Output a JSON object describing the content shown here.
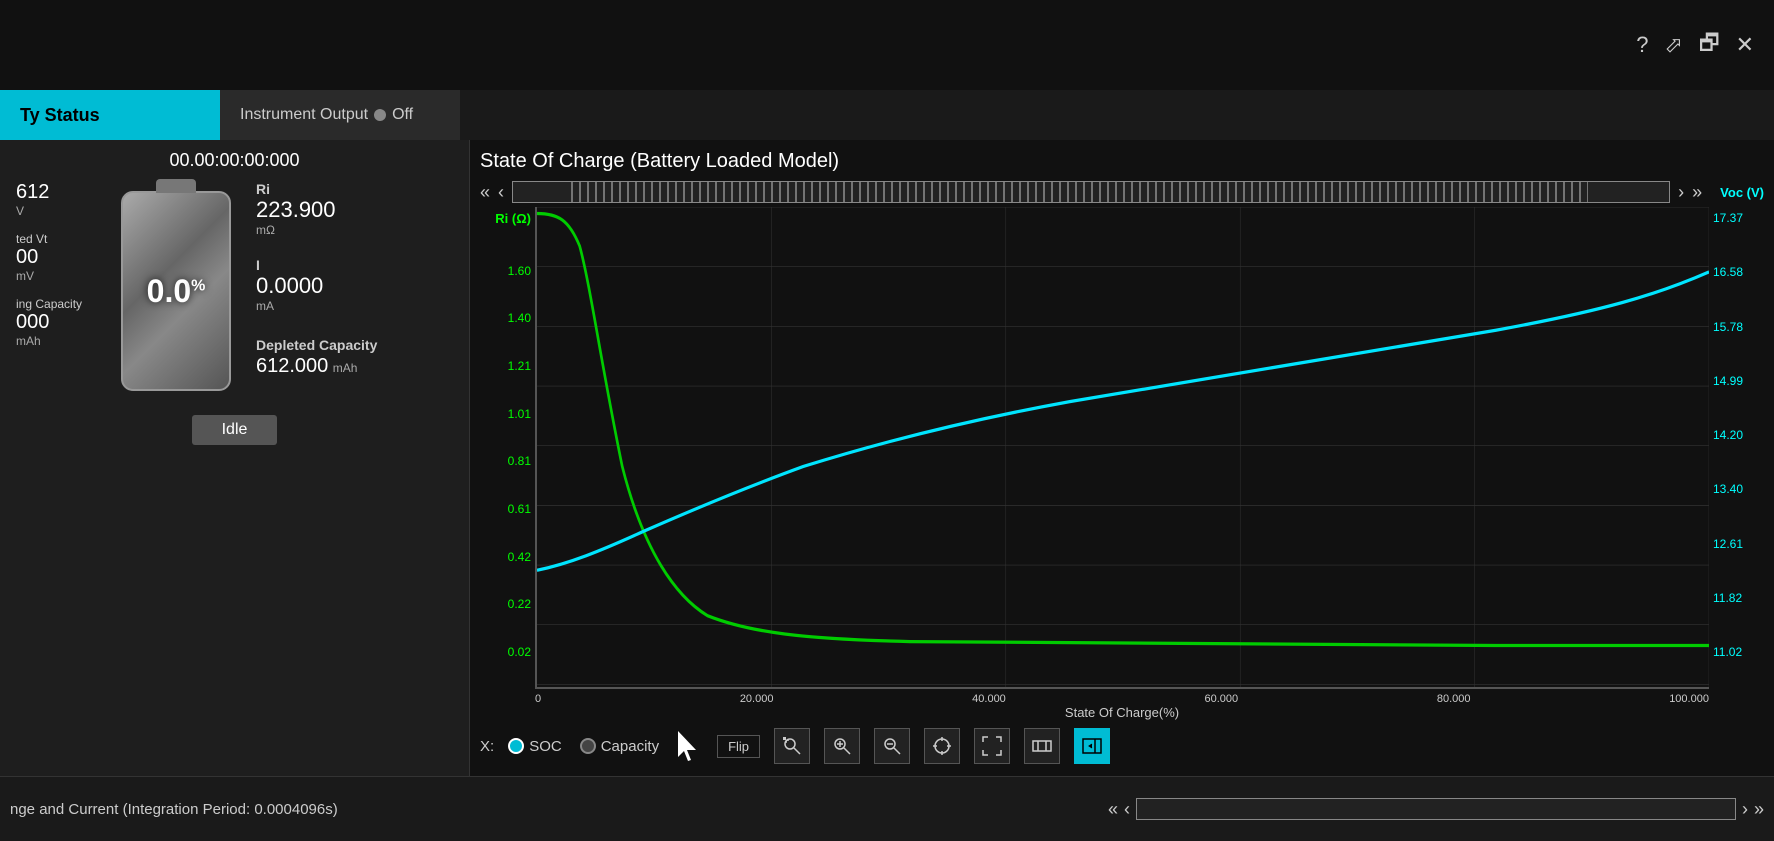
{
  "topbar": {
    "help_icon": "?",
    "export_icon": "⬀",
    "minimize_icon": "🗗",
    "close_icon": "✕"
  },
  "tabs": {
    "battery_status": "Ty Status",
    "instrument_output": "Instrument Output",
    "instrument_led": "Off"
  },
  "left_panel": {
    "timer": "00.00:00:00:000",
    "voltage_value": "612",
    "voltage_unit": "V",
    "loaded_vt_label": "ted Vt",
    "loaded_vt_value": "00",
    "loaded_vt_unit": "mV",
    "remaining_capacity_label": "ing Capacity",
    "remaining_capacity_value": "000",
    "remaining_capacity_unit": "mAh",
    "battery_percent": "0.0",
    "battery_percent_symbol": "%",
    "ri_label": "Ri",
    "ri_value": "223.900",
    "ri_unit": "mΩ",
    "i_label": "I",
    "i_value": "0.0000",
    "i_unit": "mA",
    "depleted_label": "Depleted Capacity",
    "depleted_value": "612.000",
    "depleted_unit": "mAh",
    "idle_label": "Idle"
  },
  "chart": {
    "title": "State Of Charge (Battery Loaded Model)",
    "y_left_axis": "Ri (Ω)",
    "y_right_axis": "Voc (V)",
    "y_left_values": [
      "1.60",
      "1.40",
      "1.21",
      "1.01",
      "0.81",
      "0.61",
      "0.42",
      "0.22",
      "0.02"
    ],
    "y_right_values": [
      "17.37",
      "16.58",
      "15.78",
      "14.99",
      "14.20",
      "13.40",
      "12.61",
      "11.82",
      "11.02"
    ],
    "x_values": [
      "0",
      "20.000",
      "40.000",
      "60.000",
      "80.000",
      "100.000"
    ],
    "x_axis_title": "State Of Charge(%)",
    "x_control_label": "X:",
    "radio_soc": "SOC",
    "radio_capacity": "Capacity",
    "flip_label": "Flip",
    "tools": [
      "⊕",
      "⊖",
      "✕",
      "◫",
      "⬡",
      "◀◀"
    ]
  },
  "bottom": {
    "label": "nge and Current (Integration Period: 0.0004096s)"
  }
}
